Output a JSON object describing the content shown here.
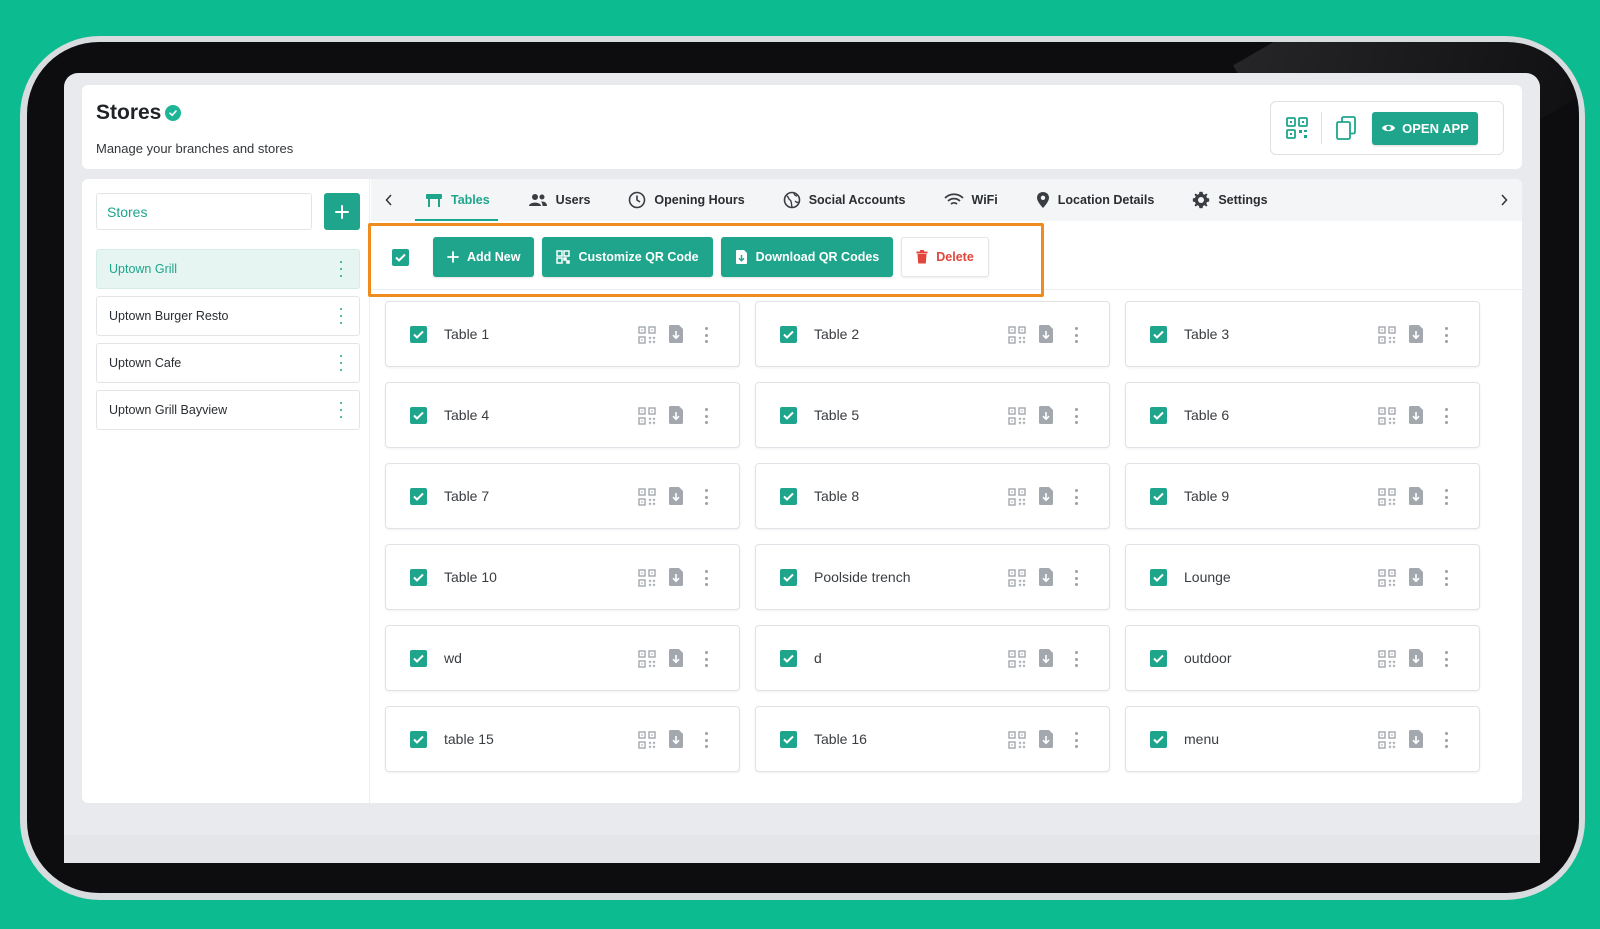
{
  "header": {
    "title": "Stores",
    "subtitle": "Manage your branches and stores",
    "open_app_label": "OPEN APP"
  },
  "sidebar": {
    "search_placeholder": "Stores",
    "stores": [
      {
        "label": "Uptown Grill",
        "active": true
      },
      {
        "label": "Uptown Burger Resto",
        "active": false
      },
      {
        "label": "Uptown Cafe",
        "active": false
      },
      {
        "label": "Uptown Grill Bayview",
        "active": false
      }
    ]
  },
  "tabs": [
    {
      "label": "Tables",
      "icon": "table-icon",
      "active": true
    },
    {
      "label": "Users",
      "icon": "users-icon"
    },
    {
      "label": "Opening Hours",
      "icon": "clock-icon"
    },
    {
      "label": "Social Accounts",
      "icon": "globe-icon"
    },
    {
      "label": "WiFi",
      "icon": "wifi-icon"
    },
    {
      "label": "Location Details",
      "icon": "location-pin-icon"
    },
    {
      "label": "Settings",
      "icon": "gear-icon"
    }
  ],
  "toolbar": {
    "add_new": "Add New",
    "customize_qr": "Customize QR Code",
    "download_qr": "Download QR Codes",
    "delete": "Delete"
  },
  "tables": [
    "Table 1",
    "Table 2",
    "Table 3",
    "Table 4",
    "Table 5",
    "Table 6",
    "Table 7",
    "Table 8",
    "Table 9",
    "Table 10",
    "Poolside trench",
    "Lounge",
    "wd",
    "d",
    "outdoor",
    "table 15",
    "Table 16",
    "menu"
  ],
  "colors": {
    "accent": "#1ea58c",
    "background": "#0dbb90",
    "delete": "#e0463c",
    "highlight": "#f08c1e"
  }
}
